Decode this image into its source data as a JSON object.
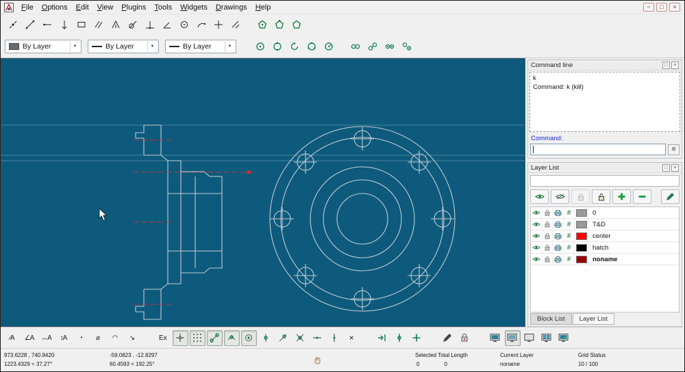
{
  "colors": {
    "canvas_background": "#0d5a7d",
    "drawing_line": "#c3cdd3",
    "centerline_red": "#b23b3b",
    "snap_green": "#0a7a4a",
    "pen_blue_label": "#1d24c8"
  },
  "menu_bar": {
    "items": [
      "File",
      "Options",
      "Edit",
      "View",
      "Plugins",
      "Tools",
      "Widgets",
      "Drawings",
      "Help"
    ]
  },
  "window_controls": [
    "minimize",
    "restore",
    "close"
  ],
  "toolbar_draw": {
    "icon_names": [
      "point",
      "line-two-points",
      "ray",
      "vertical-line",
      "rectangle",
      "parallel-lines",
      "bisector",
      "tangent-line",
      "orthogonal-line",
      "angle-line",
      "circle",
      "arc",
      "cross",
      "trim",
      "polygon-center-corner",
      "polygon-center-vertex",
      "polygon-side"
    ]
  },
  "pen_toolbar": {
    "color_value": "By Layer",
    "width_value": "By Layer",
    "linetype_value": "By Layer"
  },
  "toolbar_circle": {
    "icon_names": [
      "circle-center-point",
      "circle-2-points",
      "arc-center-point",
      "circle-3-points",
      "circle-center-radius",
      "circle-concentric",
      "circle-tangent-2",
      "circle-tangent-3",
      "circle-inscribed"
    ]
  },
  "command_dock": {
    "title": "Command line",
    "history_lines": [
      "k",
      "Command: k (kill)"
    ],
    "prompt_label": "Command:",
    "input_value": ""
  },
  "layer_dock": {
    "title": "Layer List",
    "filter_value": "",
    "toolbar_icon_names": [
      "show-all-layers",
      "hide-all-layers",
      "lock-all-layers",
      "unlock-all-layers",
      "add-layer",
      "remove-layer",
      "modify-layer"
    ],
    "layers": [
      {
        "name": "0",
        "color": "#9a9a9a",
        "visible": true,
        "current": false
      },
      {
        "name": "T&D",
        "color": "#9a9a9a",
        "visible": true,
        "current": false
      },
      {
        "name": "center",
        "color": "#ff0000",
        "visible": true,
        "current": false
      },
      {
        "name": "hatch",
        "color": "#000000",
        "visible": true,
        "current": false
      },
      {
        "name": "noname",
        "color": "#990000",
        "visible": true,
        "current": true
      }
    ],
    "tabs": [
      {
        "label": "Block List"
      },
      {
        "label": "Layer List"
      }
    ],
    "active_tab": "Layer List"
  },
  "bottom_toolbar": {
    "exclusive_label": "Ex",
    "dimension_icon_names": [
      "dim-aligned",
      "dim-linear",
      "dim-horizontal",
      "dim-vertical",
      "dim-radial",
      "dim-diametric",
      "dim-angular",
      "dim-leader"
    ],
    "snap_icon_names": [
      "snap-free",
      "snap-grid",
      "snap-endpoint",
      "snap-on-entity",
      "snap-center",
      "snap-middle",
      "snap-distance",
      "snap-intersection",
      "restrict-horizontal",
      "restrict-vertical",
      "restrict-nothing"
    ],
    "active_snaps": [
      "snap-free",
      "snap-grid",
      "snap-endpoint",
      "snap-on-entity",
      "snap-center"
    ],
    "tool_icon_names": [
      "set-relative-zero",
      "lock-relative-zero",
      "update-dimensions",
      "pen-pick",
      "pen-lock"
    ],
    "view_icon_names": [
      "screen-1",
      "screen-2",
      "screen-3",
      "screen-4",
      "screen-5"
    ]
  },
  "status_bar": {
    "absolute": {
      "line1": "973.6228 , 740.8420",
      "line2": "1223.4329 < 37.27°"
    },
    "relative": {
      "line1": "-59.0823 , -12.8297",
      "line2": "60.4593 < 192.25°"
    },
    "selection": {
      "label": "Selected Total Length",
      "count": "0",
      "total_length": "0"
    },
    "current_layer": {
      "label": "Current Layer",
      "value": "noname"
    },
    "grid": {
      "label": "Grid Status",
      "value": "10 / 100"
    }
  }
}
